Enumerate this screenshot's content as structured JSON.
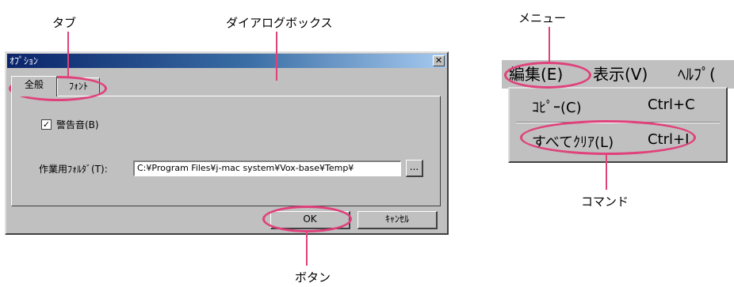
{
  "callouts": {
    "tab": "タブ",
    "dialog": "ダイアログボックス",
    "button": "ボタン",
    "menu": "メニュー",
    "command": "コマンド"
  },
  "dialog": {
    "title": "ｵﾌﾟｼｮﾝ",
    "close_label": "✕",
    "tabs": [
      {
        "label": "全般"
      },
      {
        "label": "ﾌｫﾝﾄ"
      }
    ],
    "checkbox": {
      "checked": true,
      "mark": "✓",
      "label": "警告音(B)"
    },
    "folder_label": "作業用ﾌｫﾙﾀﾞ(T):",
    "folder_value": "C:¥Program Files¥j-mac system¥Vox-base¥Temp¥",
    "browse_label": "...",
    "ok_label": "OK",
    "cancel_label": "ｷｬﾝｾﾙ"
  },
  "menu": {
    "bar": [
      {
        "label": "編集(E)"
      },
      {
        "label": "表示(V)"
      },
      {
        "label": "ﾍﾙﾌﾟ("
      }
    ],
    "items": [
      {
        "label": "ｺﾋﾟｰ(C)",
        "shortcut": "Ctrl+C"
      },
      {
        "label": "すべてｸﾘｱ(L)",
        "shortcut": "Ctrl+I"
      }
    ]
  },
  "colors": {
    "highlight": "#e0417a",
    "title_bar": "#0a246a",
    "face": "#c0c0c0"
  }
}
